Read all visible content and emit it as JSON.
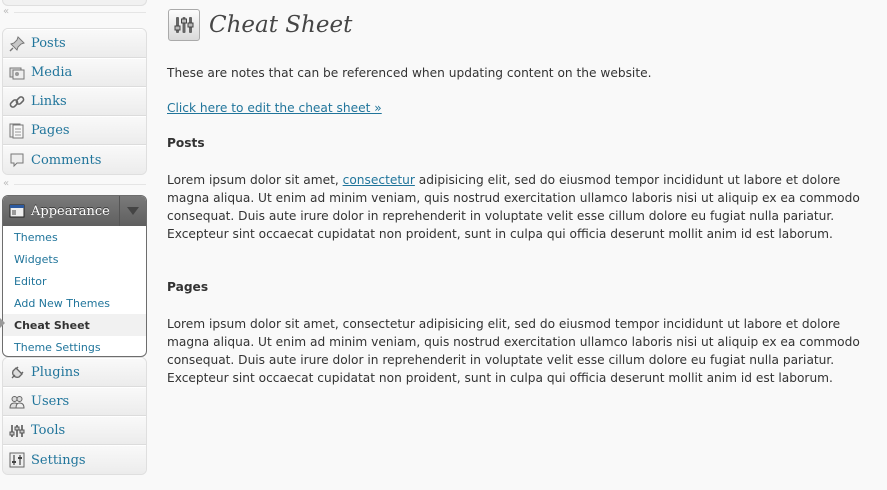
{
  "sidebar": {
    "group_top": [
      {
        "label": "Posts",
        "icon": "pushpin-icon"
      },
      {
        "label": "Media",
        "icon": "media-icon"
      },
      {
        "label": "Links",
        "icon": "link-icon"
      },
      {
        "label": "Pages",
        "icon": "pages-icon"
      },
      {
        "label": "Comments",
        "icon": "comments-icon"
      }
    ],
    "appearance": {
      "label": "Appearance",
      "icon": "appearance-icon",
      "submenu": [
        "Themes",
        "Widgets",
        "Editor",
        "Add New Themes",
        "Cheat Sheet",
        "Theme Settings"
      ],
      "current": "Cheat Sheet"
    },
    "group_bottom": [
      {
        "label": "Plugins",
        "icon": "plugin-icon"
      },
      {
        "label": "Users",
        "icon": "users-icon"
      },
      {
        "label": "Tools",
        "icon": "tools-icon"
      },
      {
        "label": "Settings",
        "icon": "settings-icon"
      }
    ],
    "separator_glyph": "«"
  },
  "page": {
    "title": "Cheat Sheet",
    "intro": "These are notes that can be referenced when updating content on the website.",
    "edit_link": "Click here to edit the cheat sheet »",
    "sections": [
      {
        "heading": "Posts",
        "before_link": "Lorem ipsum dolor sit amet, ",
        "link": "consectetur",
        "after_link": " adipisicing elit, sed do eiusmod tempor incididunt ut labore et dolore magna aliqua. Ut enim ad minim veniam, quis nostrud exercitation ullamco laboris nisi ut aliquip ex ea commodo consequat. Duis aute irure dolor in reprehenderit in voluptate velit esse cillum dolore eu fugiat nulla pariatur. Excepteur sint occaecat cupidatat non proident, sunt in culpa qui officia deserunt mollit anim id est laborum."
      },
      {
        "heading": "Pages",
        "body": "Lorem ipsum dolor sit amet, consectetur adipisicing elit, sed do eiusmod tempor incididunt ut labore et dolore magna aliqua. Ut enim ad minim veniam, quis nostrud exercitation ullamco laboris nisi ut aliquip ex ea commodo consequat. Duis aute irure dolor in reprehenderit in voluptate velit esse cillum dolore eu fugiat nulla pariatur. Excepteur sint occaecat cupidatat non proident, sunt in culpa qui officia deserunt mollit anim id est laborum."
      }
    ]
  },
  "colors": {
    "link": "#21759b",
    "text": "#333333",
    "appearance_header": "#6d6d6d",
    "background": "#f9f9f9"
  }
}
